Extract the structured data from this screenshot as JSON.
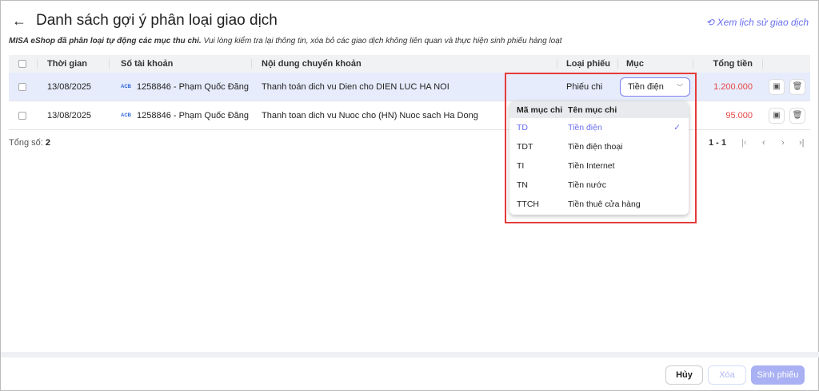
{
  "header": {
    "title": "Danh sách gợi ý phân loại giao dịch",
    "history_link": "Xem lịch sử giao dịch",
    "note_bold": "MISA eShop đã phân loại tự động các mục thu chi.",
    "note_rest": " Vui lòng kiểm tra lại thông tin, xóa bỏ các giao dịch không liên quan và thực hiện sinh phiếu hàng loạt"
  },
  "table": {
    "columns": [
      "Thời gian",
      "Số tài khoản",
      "Nội dung chuyển khoản",
      "Loại phiếu",
      "Mục",
      "Tổng tiền"
    ],
    "rows": [
      {
        "time": "13/08/2025",
        "bank": "ACB",
        "account": "1258846 - Phạm Quốc Đăng",
        "content": "Thanh toán dich vu Dien cho DIEN LUC HA NOI",
        "type": "Phiếu chi",
        "category": "Tiền điện",
        "total": "1.200.000"
      },
      {
        "time": "13/08/2025",
        "bank": "ACB",
        "account": "1258846 - Phạm Quốc Đăng",
        "content": "Thanh toan dich vu Nuoc cho (HN) Nuoc sach Ha Dong",
        "type": "",
        "category": "",
        "total": "95.000"
      }
    ]
  },
  "footer": {
    "total_label": "Tổng số:",
    "total_value": "2",
    "page_range": "1 - 1"
  },
  "dropdown": {
    "col_code": "Mã mục chi",
    "col_name": "Tên mục chi",
    "items": [
      {
        "code": "TD",
        "name": "Tiền điện",
        "selected": true
      },
      {
        "code": "TDT",
        "name": "Tiền điện thoại"
      },
      {
        "code": "TI",
        "name": "Tiền Internet"
      },
      {
        "code": "TN",
        "name": "Tiền nước"
      },
      {
        "code": "TTCH",
        "name": "Tiền thuê cửa hàng"
      }
    ]
  },
  "actions": {
    "cancel": "Hủy",
    "delete": "Xóa",
    "generate": "Sinh phiếu"
  },
  "colors": {
    "accent": "#6a6ff0",
    "amount": "#e84545",
    "highlight": "#e53b3b"
  }
}
